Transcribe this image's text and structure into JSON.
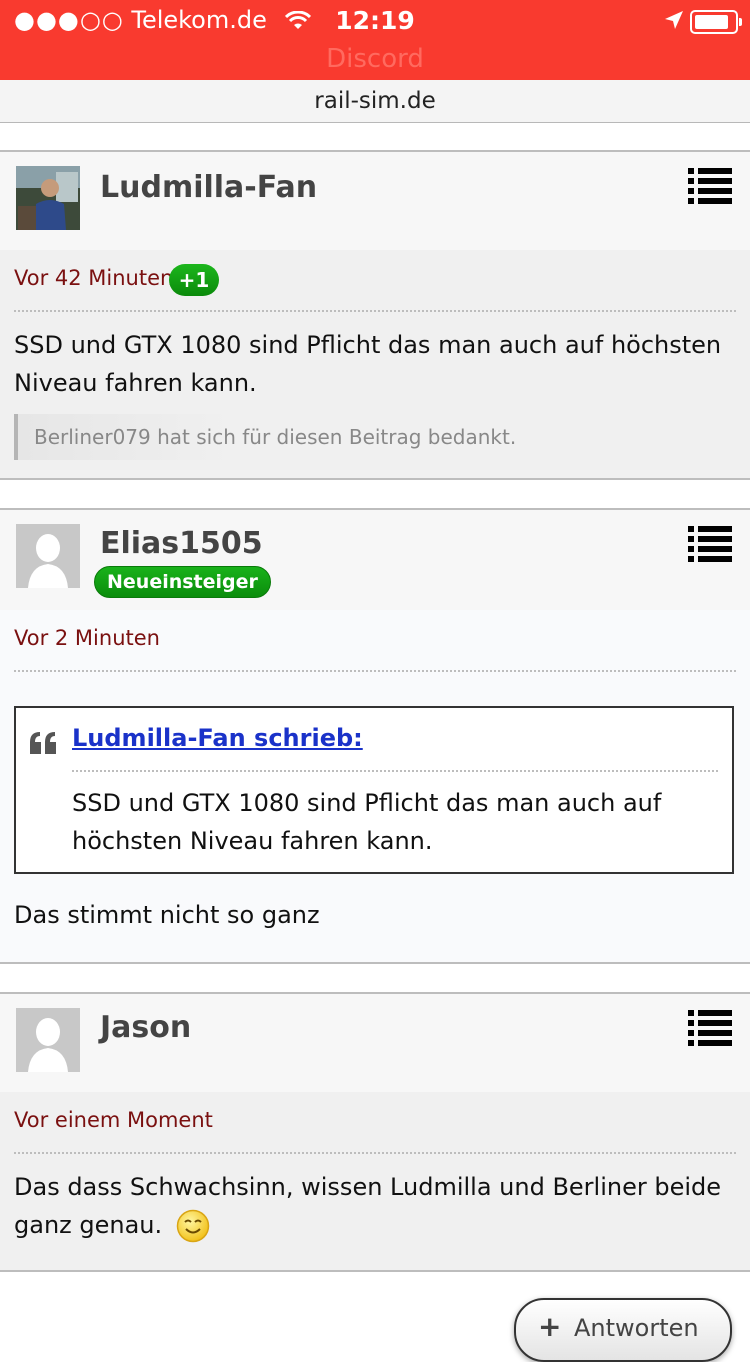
{
  "status_bar": {
    "signal": "●●●○○",
    "carrier": "Telekom.de",
    "time": "12:19",
    "app_ghost": "Discord"
  },
  "browser": {
    "url": "rail-sim.de"
  },
  "posts": [
    {
      "username": "Ludmilla-Fan",
      "time": "Vor 42 Minuten",
      "likes": "+1",
      "message": "SSD und GTX 1080 sind Pflicht das man auch auf höchsten Niveau fahren kann.",
      "thanks": "Berliner079 hat sich für diesen Beitrag bedankt."
    },
    {
      "username": "Elias1505",
      "rank": "Neueinsteiger",
      "time": "Vor 2 Minuten",
      "quote": {
        "author": "Ludmilla-Fan schrieb:",
        "text": "SSD und GTX 1080 sind Pflicht das man auch auf höchsten Niveau fahren kann."
      },
      "message": "Das stimmt nicht so ganz"
    },
    {
      "username": "Jason",
      "time": "Vor einem Moment",
      "message": "Das dass Schwachsinn, wissen Ludmilla und Berliner beide ganz genau."
    }
  ],
  "reply_button": {
    "icon": "+",
    "label": "Antworten"
  },
  "colors": {
    "status_bar": "#f93a2f",
    "time_text": "#7a1010",
    "badge_green": "#0f9a10",
    "quote_link": "#1a32c9"
  },
  "icons": {
    "menu": "list-icon",
    "quote": "quote-icon",
    "smiley": "smiley-icon"
  }
}
